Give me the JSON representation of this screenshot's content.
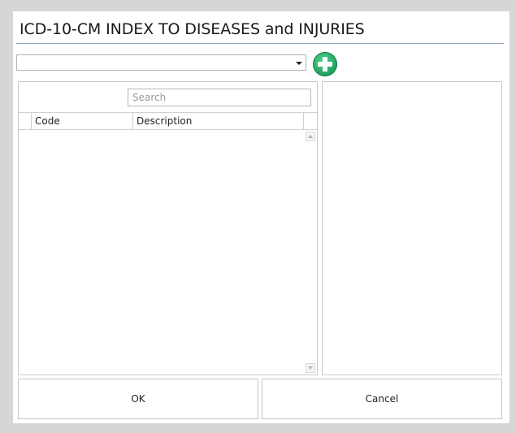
{
  "dialog": {
    "title": "ICD-10-CM INDEX TO DISEASES and INJURIES"
  },
  "toolbar": {
    "combo_value": "",
    "combo_arrow_icon": "chevron-down-icon",
    "add_icon": "plus-circle-icon",
    "add_color": "#22a35f"
  },
  "search": {
    "placeholder": "Search",
    "value": ""
  },
  "grid": {
    "columns": [
      "",
      "Code",
      "Description"
    ],
    "rows": []
  },
  "buttons": {
    "ok_label": "OK",
    "cancel_label": "Cancel"
  },
  "colors": {
    "title_rule": "#8aa6c1",
    "background": "#d6d6d6"
  }
}
